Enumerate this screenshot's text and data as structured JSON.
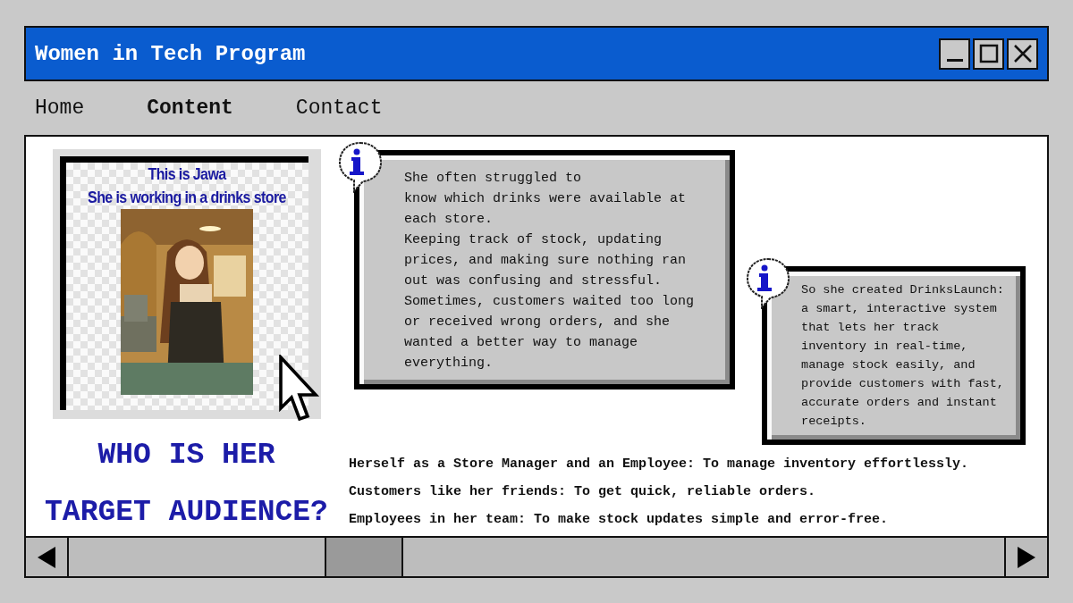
{
  "window": {
    "title": "Women in Tech Program"
  },
  "nav": [
    {
      "label": "Home",
      "selected": false
    },
    {
      "label": "Content",
      "selected": true
    },
    {
      "label": "Contact",
      "selected": false
    }
  ],
  "profile": {
    "caption_lines": [
      "This is Jawa",
      "She is working in a drinks store"
    ],
    "image": {
      "kind": "picture"
    }
  },
  "heading_lines": [
    "WHO IS HER",
    "TARGET AUDIENCE?"
  ],
  "info_boxes": [
    {
      "text": "She often struggled to\nknow which drinks were available at\neach store.\nKeeping track of stock, updating\nprices, and making sure nothing ran\nout was confusing and stressful.\nSometimes, customers waited too long\nor received wrong orders, and she\nwanted a better way to manage\neverything."
    },
    {
      "text": "So she created DrinksLaunch:\na smart, interactive system\nthat lets her track\ninventory in real-time,\nmanage stock easily, and\nprovide customers with fast,\naccurate orders and instant\nreceipts."
    }
  ],
  "audience": [
    "Herself as a Store Manager and an Employee: To manage inventory effortlessly.",
    "Customers like her friends: To get quick, reliable orders.",
    "Employees in her team: To make stock updates simple and error-free."
  ]
}
